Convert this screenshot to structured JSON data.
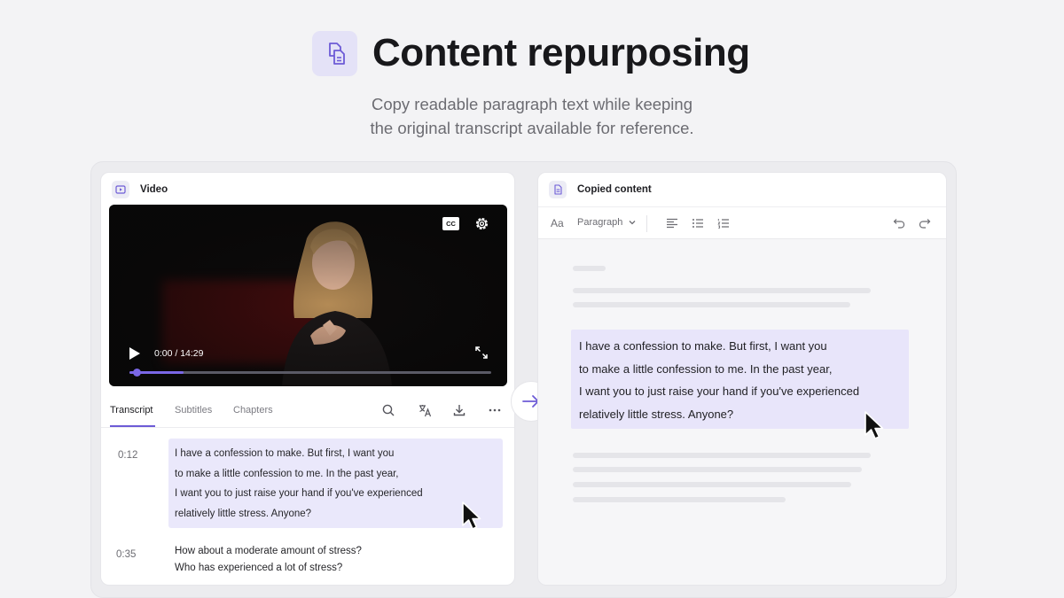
{
  "hero": {
    "title": "Content repurposing",
    "subtitle_line1": "Copy readable paragraph text while keeping",
    "subtitle_line2": "the original transcript available for reference.",
    "icon": "copy-document-icon"
  },
  "colors": {
    "accent": "#6d5bd6",
    "highlight": "#eae8fb",
    "progress": "#7a67e6"
  },
  "video_panel": {
    "title": "Video",
    "player": {
      "cc_label": "CC",
      "time": "0:00 / 14:29",
      "progress_fraction": 0.15
    },
    "tabs": [
      {
        "label": "Transcript",
        "active": true
      },
      {
        "label": "Subtitles",
        "active": false
      },
      {
        "label": "Chapters",
        "active": false
      }
    ],
    "tools": [
      "search-icon",
      "translate-icon",
      "download-icon",
      "more-icon"
    ],
    "transcript": [
      {
        "time": "0:12",
        "lines": [
          "I have a confession to make. But first, I want you",
          "to make a little confession to me. In the past year,",
          "I want you to just raise your hand if you've experienced",
          "relatively little stress. Anyone?"
        ],
        "selected": true
      },
      {
        "time": "0:35",
        "lines": [
          "How about a moderate amount of stress?",
          "Who has experienced a lot of stress?"
        ],
        "selected": false
      }
    ]
  },
  "content_panel": {
    "title": "Copied content",
    "toolbar": {
      "font_label": "Aa",
      "style_label": "Paragraph"
    },
    "pasted_lines": [
      "I have a confession to make. But first, I want you",
      "to make a little confession to me. In the past year,",
      "I want you to just raise your hand if you've experienced",
      "relatively little stress. Anyone?"
    ]
  }
}
